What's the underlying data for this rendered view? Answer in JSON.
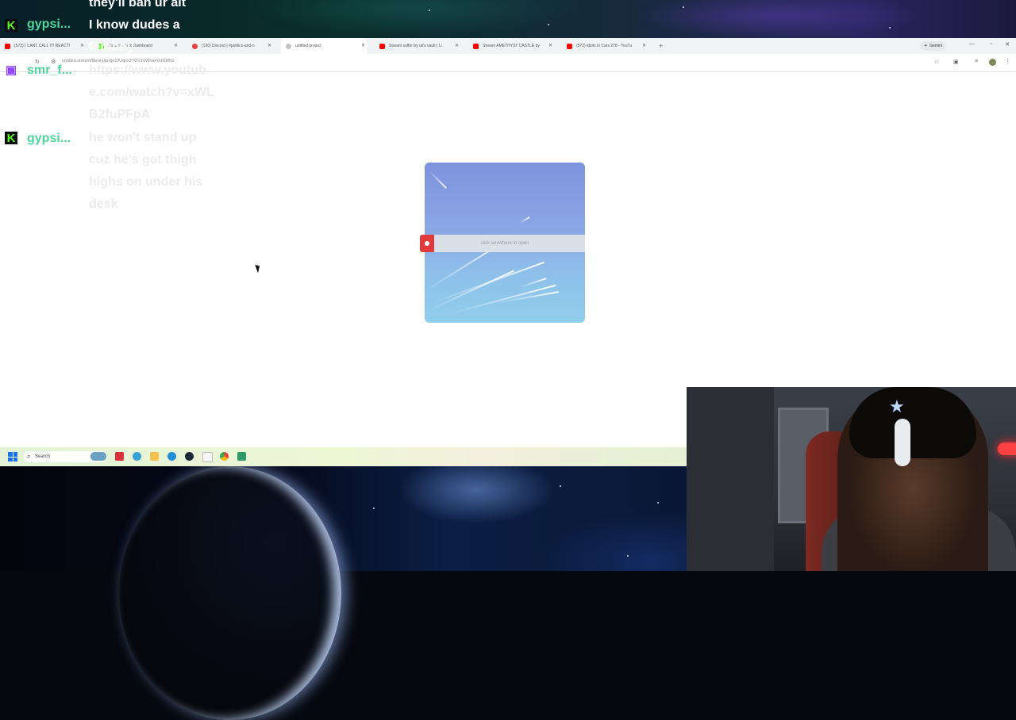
{
  "chat": {
    "messages": [
      {
        "platform": "kick",
        "user": "",
        "text": "they'll ban ur alt"
      },
      {
        "platform": "kick",
        "user": "gypsi...",
        "text": "I know dudes a femboy"
      },
      {
        "platform": "twitch",
        "user": "smr_f...",
        "text": "https://www.youtube.com/watch?v=xWLB2fuPFpA"
      },
      {
        "platform": "kick",
        "user": "gypsi...",
        "text": "he won't stand up cuz he's got thigh highs on under his desk"
      }
    ]
  },
  "browser": {
    "tabs": [
      {
        "label": "(572) I CANT CALL IT! REACTI",
        "fav_color": "#ff0000",
        "active": false
      },
      {
        "label": "Stream - Kick Dashboard",
        "fav_color": "#53fc18",
        "active": false
      },
      {
        "label": "(130) Discord | #politics-and-n",
        "fav_color": "#5865f2",
        "active": false
      },
      {
        "label": "untitled project",
        "fav_color": "#c4c4c4",
        "active": true
      },
      {
        "label": "Stream suffer by uk's vault | Li",
        "fav_color": "#ff0000",
        "active": false
      },
      {
        "label": "Stream AMETHYST CASTLE by",
        "fav_color": "#ff0000",
        "active": false
      },
      {
        "label": "(572) idiots in Cars 278 - YouTu",
        "fav_color": "#ff0000",
        "active": false
      }
    ],
    "gemini_label": "Gemini",
    "url": "untitled.stream/library/project/UqloUYOV10WhamXnOiBG"
  },
  "card": {
    "open_label": "click anywhere to open"
  },
  "taskbar": {
    "search_label": "Search"
  },
  "colors": {
    "kick_green": "#53fc18",
    "twitch_purple": "#9146ff",
    "record_red": "#e03a3a"
  }
}
